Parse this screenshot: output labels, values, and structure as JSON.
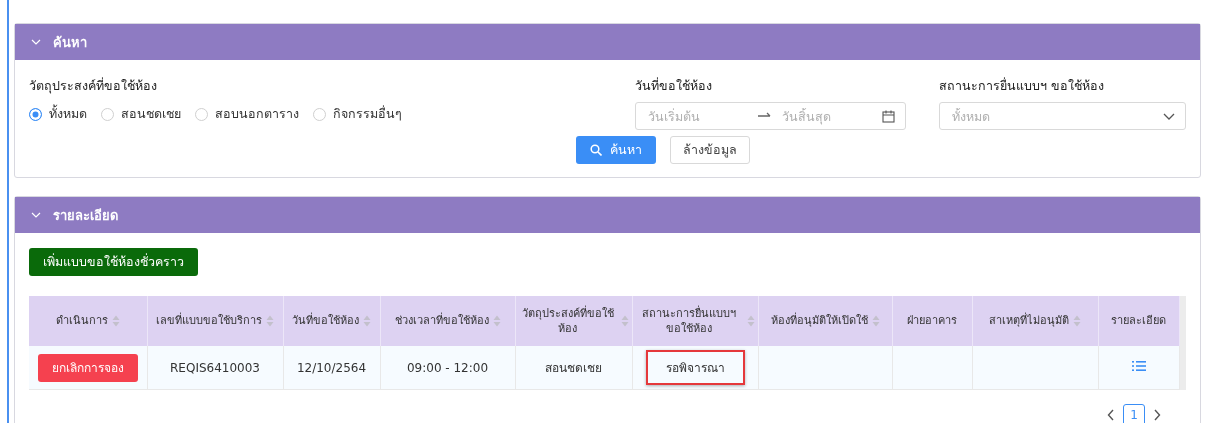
{
  "search_panel": {
    "title": "ค้นหา",
    "expanded": true,
    "purpose": {
      "label": "วัตถุประสงค์ที่ขอใช้ห้อง",
      "options": [
        {
          "label": "ทั้งหมด",
          "selected": true
        },
        {
          "label": "สอนชดเชย",
          "selected": false
        },
        {
          "label": "สอบนอกตาราง",
          "selected": false
        },
        {
          "label": "กิจกรรมอื่นๆ",
          "selected": false
        }
      ]
    },
    "date": {
      "label": "วันที่ขอใช้ห้อง",
      "start_placeholder": "วันเริ่มต้น",
      "end_placeholder": "วันสิ้นสุด"
    },
    "status": {
      "label": "สถานะการยื่นแบบฯ ขอใช้ห้อง",
      "placeholder": "ทั้งหมด"
    },
    "search_button": "ค้นหา",
    "clear_button": "ล้างข้อมูล"
  },
  "details_panel": {
    "title": "รายละเอียด",
    "expanded": true,
    "add_button": "เพิ่มแบบขอใช้ห้องชั่วคราว",
    "table": {
      "columns": [
        {
          "label": "ดำเนินการ",
          "sortable": true
        },
        {
          "label": "เลขที่แบบขอใช้บริการ",
          "sortable": true
        },
        {
          "label": "วันที่ขอใช้ห้อง",
          "sortable": true
        },
        {
          "label": "ช่วงเวลาที่ขอใช้ห้อง",
          "sortable": true
        },
        {
          "label": "วัตถุประสงค์ที่ขอใช้ห้อง",
          "sortable": true
        },
        {
          "label": "สถานะการยื่นแบบฯ ขอใช้ห้อง",
          "sortable": true
        },
        {
          "label": "ห้องที่อนุมัติให้เปิดใช้",
          "sortable": true
        },
        {
          "label": "ฝ่ายอาคาร",
          "sortable": false
        },
        {
          "label": "สาเหตุที่ไม่อนุมัติ",
          "sortable": true
        },
        {
          "label": "รายละเอียด",
          "sortable": false
        }
      ],
      "rows": [
        {
          "action": "ยกเลิกการจอง",
          "request_no": "REQIS6410003",
          "date": "12/10/2564",
          "time": "09:00 - 12:00",
          "purpose": "สอนชดเชย",
          "status": "รอพิจารณา",
          "status_highlighted": true
        }
      ]
    },
    "pagination": {
      "pages": [
        {
          "label": "1",
          "selected": true
        }
      ]
    }
  }
}
